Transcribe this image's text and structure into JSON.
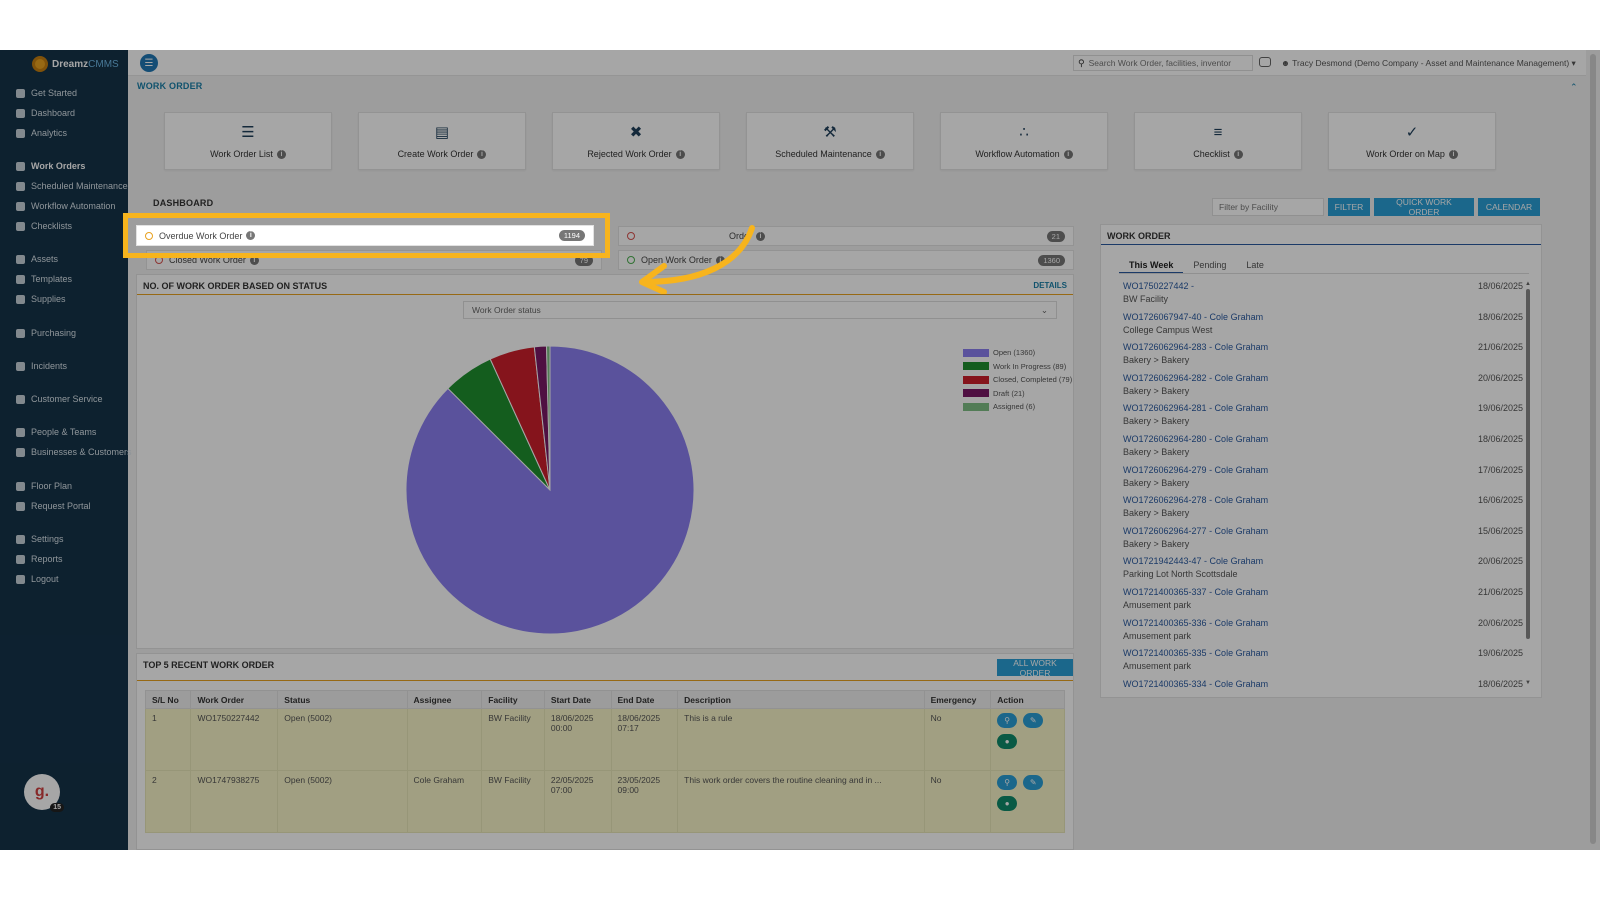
{
  "app": {
    "brand_main": "Dreamz",
    "brand_accent": "CMMS"
  },
  "sidebar": {
    "items": [
      {
        "label": "Get Started",
        "icon": "gears-icon"
      },
      {
        "label": "Dashboard",
        "icon": "dashboard-icon"
      },
      {
        "label": "Analytics",
        "icon": "analytics-icon"
      },
      {
        "label": "Work Orders",
        "icon": "wrench-icon"
      },
      {
        "label": "Scheduled Maintenance",
        "icon": "wrench-icon"
      },
      {
        "label": "Workflow Automation",
        "icon": "flow-icon"
      },
      {
        "label": "Checklists",
        "icon": "check-icon"
      },
      {
        "label": "Assets",
        "icon": "assets-icon"
      },
      {
        "label": "Templates",
        "icon": "templates-icon"
      },
      {
        "label": "Supplies",
        "icon": "supplies-icon"
      },
      {
        "label": "Purchasing",
        "icon": "cart-icon"
      },
      {
        "label": "Incidents",
        "icon": "incidents-icon"
      },
      {
        "label": "Customer Service",
        "icon": "service-icon"
      },
      {
        "label": "People & Teams",
        "icon": "people-icon"
      },
      {
        "label": "Businesses & Customers",
        "icon": "business-icon"
      },
      {
        "label": "Floor Plan",
        "icon": "floorplan-icon"
      },
      {
        "label": "Request Portal",
        "icon": "portal-icon"
      },
      {
        "label": "Settings",
        "icon": "gear-icon"
      },
      {
        "label": "Reports",
        "icon": "reports-icon"
      },
      {
        "label": "Logout",
        "icon": "logout-icon"
      }
    ],
    "avatar_letter": "g.",
    "avatar_badge": "15"
  },
  "topbar": {
    "search_placeholder": "Search Work Order, facilities, inventor",
    "user": "Tracy Desmond (Demo Company - Asset and Maintenance Management)"
  },
  "work_order_section": {
    "title": "WORK ORDER",
    "cards": [
      {
        "label": "Work Order List",
        "icon": "list-icon"
      },
      {
        "label": "Create Work Order",
        "icon": "document-icon"
      },
      {
        "label": "Rejected Work Order",
        "icon": "rejected-icon"
      },
      {
        "label": "Scheduled Maintenance",
        "icon": "tools-icon"
      },
      {
        "label": "Workflow Automation",
        "icon": "workflow-icon"
      },
      {
        "label": "Checklist",
        "icon": "checklist-icon"
      },
      {
        "label": "Work Order on Map",
        "icon": "map-check-icon"
      }
    ]
  },
  "dashboard": {
    "title": "DASHBOARD",
    "filter_placeholder": "Filter by Facility",
    "filter_button": "FILTER",
    "quick_button": "QUICK WORK ORDER",
    "calendar_button": "CALENDAR",
    "stats": [
      {
        "label": "Overdue Work Order",
        "count": "1194"
      },
      {
        "label": "Closed Work Order",
        "count": "79"
      },
      {
        "label": "Order",
        "count": "21"
      },
      {
        "label": "Open Work Order",
        "count": "1360"
      }
    ]
  },
  "status_chart": {
    "title": "NO. OF WORK ORDER BASED ON STATUS",
    "details_link": "DETAILS",
    "select_value": "Work Order status"
  },
  "chart_data": {
    "type": "pie",
    "categories": [
      "Open",
      "Work In Progress",
      "Closed, Completed",
      "Draft",
      "Assigned"
    ],
    "values": [
      1360,
      89,
      79,
      21,
      6
    ],
    "legend_labels": [
      "Open (1360)",
      "Work In Progress (89)",
      "Closed, Completed (79)",
      "Draft (21)",
      "Assigned (6)"
    ],
    "colors": [
      "#8a7ff0",
      "#1f8f2f",
      "#cc1f2b",
      "#7a1a66",
      "#7fbf84"
    ],
    "legend_position": "right"
  },
  "recent": {
    "title": "TOP 5 RECENT WORK ORDER",
    "all_button": "ALL WORK ORDER",
    "columns": [
      "S/L No",
      "Work Order",
      "Status",
      "Assignee",
      "Facility",
      "Start Date",
      "End Date",
      "Description",
      "Emergency",
      "Action"
    ],
    "rows": [
      {
        "sl": "1",
        "wo": "WO1750227442",
        "status": "Open (5002)",
        "assignee": "",
        "facility": "BW Facility",
        "start": "18/06/2025 00:00",
        "end": "18/06/2025 07:17",
        "desc": "This is a rule",
        "emergency": "No"
      },
      {
        "sl": "2",
        "wo": "WO1747938275",
        "status": "Open (5002)",
        "assignee": "Cole Graham",
        "facility": "BW Facility",
        "start": "22/05/2025 07:00",
        "end": "23/05/2025 09:00",
        "desc": "This work order covers the routine cleaning and in ...",
        "emergency": "No"
      }
    ]
  },
  "wo_panel": {
    "title": "WORK ORDER",
    "tabs": [
      "This Week",
      "Pending",
      "Late"
    ],
    "items": [
      {
        "num": "WO1750227442 -",
        "sub": "BW Facility",
        "date": "18/06/2025"
      },
      {
        "num": "WO1726067947-40 - Cole Graham",
        "sub": "College Campus West",
        "date": "18/06/2025"
      },
      {
        "num": "WO1726062964-283 - Cole Graham",
        "sub": "Bakery > Bakery",
        "date": "21/06/2025"
      },
      {
        "num": "WO1726062964-282 - Cole Graham",
        "sub": "Bakery > Bakery",
        "date": "20/06/2025"
      },
      {
        "num": "WO1726062964-281 - Cole Graham",
        "sub": "Bakery > Bakery",
        "date": "19/06/2025"
      },
      {
        "num": "WO1726062964-280 - Cole Graham",
        "sub": "Bakery > Bakery",
        "date": "18/06/2025"
      },
      {
        "num": "WO1726062964-279 - Cole Graham",
        "sub": "Bakery > Bakery",
        "date": "17/06/2025"
      },
      {
        "num": "WO1726062964-278 - Cole Graham",
        "sub": "Bakery > Bakery",
        "date": "16/06/2025"
      },
      {
        "num": "WO1726062964-277 - Cole Graham",
        "sub": "Bakery > Bakery",
        "date": "15/06/2025"
      },
      {
        "num": "WO1721942443-47 - Cole Graham",
        "sub": "Parking Lot North Scottsdale",
        "date": "20/06/2025"
      },
      {
        "num": "WO1721400365-337 - Cole Graham",
        "sub": "Amusement park",
        "date": "21/06/2025"
      },
      {
        "num": "WO1721400365-336 - Cole Graham",
        "sub": "Amusement park",
        "date": "20/06/2025"
      },
      {
        "num": "WO1721400365-335 - Cole Graham",
        "sub": "Amusement park",
        "date": "19/06/2025"
      },
      {
        "num": "WO1721400365-334 - Cole Graham",
        "sub": "",
        "date": "18/06/2025"
      }
    ]
  }
}
